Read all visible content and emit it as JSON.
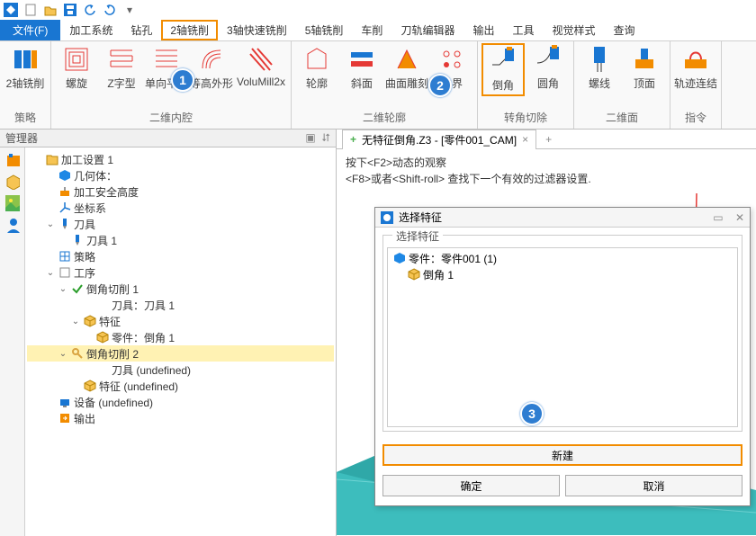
{
  "menu": {
    "file": "文件(F)",
    "items": [
      "加工系统",
      "钻孔",
      "2轴铣削",
      "3轴快速铣削",
      "5轴铣削",
      "车削",
      "刀轨编辑器",
      "输出",
      "工具",
      "视觉样式",
      "查询"
    ]
  },
  "ribbon": {
    "groups": [
      {
        "cap": "策略",
        "btns": [
          "2轴铣削"
        ]
      },
      {
        "cap": "二维内腔",
        "btns": [
          "螺旋",
          "Z字型",
          "单向平行",
          "等高外形",
          "VoluMill2x"
        ]
      },
      {
        "cap": "二维轮廓",
        "btns": [
          "轮廓",
          "斜面",
          "曲面雕刻",
          "边界"
        ]
      },
      {
        "cap": "转角切除",
        "btns": [
          "倒角",
          "圆角"
        ]
      },
      {
        "cap": "二维面",
        "btns": [
          "螺线",
          "顶面"
        ]
      },
      {
        "cap": "指令",
        "btns": [
          "轨迹连结"
        ]
      }
    ]
  },
  "mgr": {
    "title": "管理器"
  },
  "tree": [
    {
      "ind": 0,
      "tgl": "",
      "ic": "folder",
      "tx": "加工设置 1",
      "col": "#D9A441"
    },
    {
      "ind": 1,
      "tgl": "",
      "ic": "geo",
      "tx": "几何体：",
      "col": "#1976D2"
    },
    {
      "ind": 1,
      "tgl": "",
      "ic": "safe",
      "tx": "加工安全高度",
      "col": "#F28C00"
    },
    {
      "ind": 1,
      "tgl": "",
      "ic": "axis",
      "tx": "坐标系",
      "col": "#1976D2"
    },
    {
      "ind": 1,
      "tgl": "⌄",
      "ic": "tool",
      "tx": "刀具",
      "col": "#1976D2"
    },
    {
      "ind": 2,
      "tgl": "",
      "ic": "tool",
      "tx": "刀具 1",
      "col": "#1976D2"
    },
    {
      "ind": 1,
      "tgl": "",
      "ic": "tac",
      "tx": "策略",
      "col": "#1976D2"
    },
    {
      "ind": 1,
      "tgl": "⌄",
      "ic": "box",
      "tx": "工序",
      "col": "#888"
    },
    {
      "ind": 2,
      "tgl": "⌄",
      "ic": "chk",
      "tx": "倒角切削 1",
      "col": "#2a9d2a"
    },
    {
      "ind": 4,
      "tgl": "",
      "ic": "",
      "tx": "刀具：刀具 1",
      "col": ""
    },
    {
      "ind": 3,
      "tgl": "⌄",
      "ic": "cube",
      "tx": "特征",
      "col": "#D9A441"
    },
    {
      "ind": 4,
      "tgl": "",
      "ic": "cube",
      "tx": "零件：倒角 1",
      "col": "#D9A441"
    },
    {
      "ind": 2,
      "tgl": "⌄",
      "ic": "key",
      "tx": "倒角切削 2",
      "col": "#D9A441",
      "hl": 1
    },
    {
      "ind": 4,
      "tgl": "",
      "ic": "",
      "tx": "刀具 (undefined)",
      "col": ""
    },
    {
      "ind": 3,
      "tgl": "",
      "ic": "cube",
      "tx": "特征 (undefined)",
      "col": "#D9A441"
    },
    {
      "ind": 1,
      "tgl": "",
      "ic": "dev",
      "tx": "设备 (undefined)",
      "col": "#1976D2"
    },
    {
      "ind": 1,
      "tgl": "",
      "ic": "out",
      "tx": "输出",
      "col": "#F28C00"
    }
  ],
  "tab": {
    "title": "无特征倒角.Z3 - [零件001_CAM]",
    "plus": "+",
    "close": "×"
  },
  "hint": {
    "l1": "按下<F2>动态的观察",
    "l2": "<F8>或者<Shift-roll> 查找下一个有效的过滤器设置."
  },
  "dlg": {
    "title": "选择特征",
    "legend": "选择特征",
    "items": [
      {
        "tx": "零件：零件001 (1)",
        "ic": "cube",
        "col": "#1E88E5"
      },
      {
        "tx": "倒角 1",
        "ic": "cube",
        "col": "#D9A441",
        "ind": 1
      }
    ],
    "new": "新建",
    "ok": "确定",
    "cancel": "取消"
  },
  "badges": {
    "b1": "1",
    "b2": "2",
    "b3": "3"
  }
}
